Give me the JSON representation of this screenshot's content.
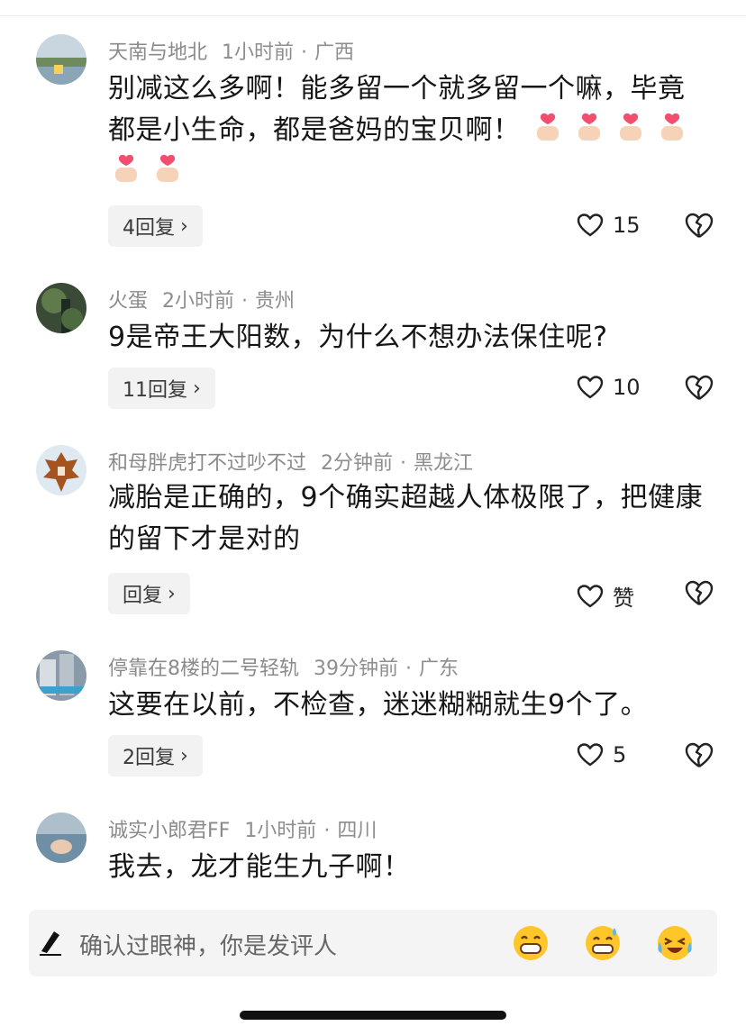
{
  "comments": [
    {
      "username": "天南与地北",
      "time": "1小时前",
      "location": "广西",
      "text": "别减这么多啊！能多留一个就多留一个嘛，毕竟都是小生命，都是爸妈的宝贝啊！",
      "emoji": "finger-heart-icon ×6",
      "reply_label": "4回复",
      "like_count": "15"
    },
    {
      "username": "火蛋",
      "time": "2小时前",
      "location": "贵州",
      "text": "9是帝王大阳数，为什么不想办法保住呢?",
      "reply_label": "11回复",
      "like_count": "10"
    },
    {
      "username": "和母胖虎打不过吵不过",
      "time": "2分钟前",
      "location": "黑龙江",
      "text": "减胎是正确的，9个确实超越人体极限了，把健康的留下才是对的",
      "reply_label": "回复",
      "like_count": "赞"
    },
    {
      "username": "停靠在8楼的二号轻轨",
      "time": "39分钟前",
      "location": "广东",
      "text": "这要在以前，不检查，迷迷糊糊就生9个了。",
      "reply_label": "2回复",
      "like_count": "5"
    },
    {
      "username": "诚实小郎君FF",
      "time": "1小时前",
      "location": "四川",
      "text": "我去，龙才能生九子啊！"
    }
  ],
  "input": {
    "placeholder": "确认过眼神，你是发评人"
  },
  "icons": [
    "finger-heart-icon",
    "heart-outline-icon",
    "broken-heart-icon",
    "pen-icon",
    "grin-emoji-icon",
    "sweat-emoji-icon",
    "laugh-cry-emoji-icon"
  ],
  "colors": {
    "accent_heart": "#f0506e",
    "text": "#161616",
    "meta": "#8e8e8e",
    "button_bg": "#f2f2f2"
  }
}
